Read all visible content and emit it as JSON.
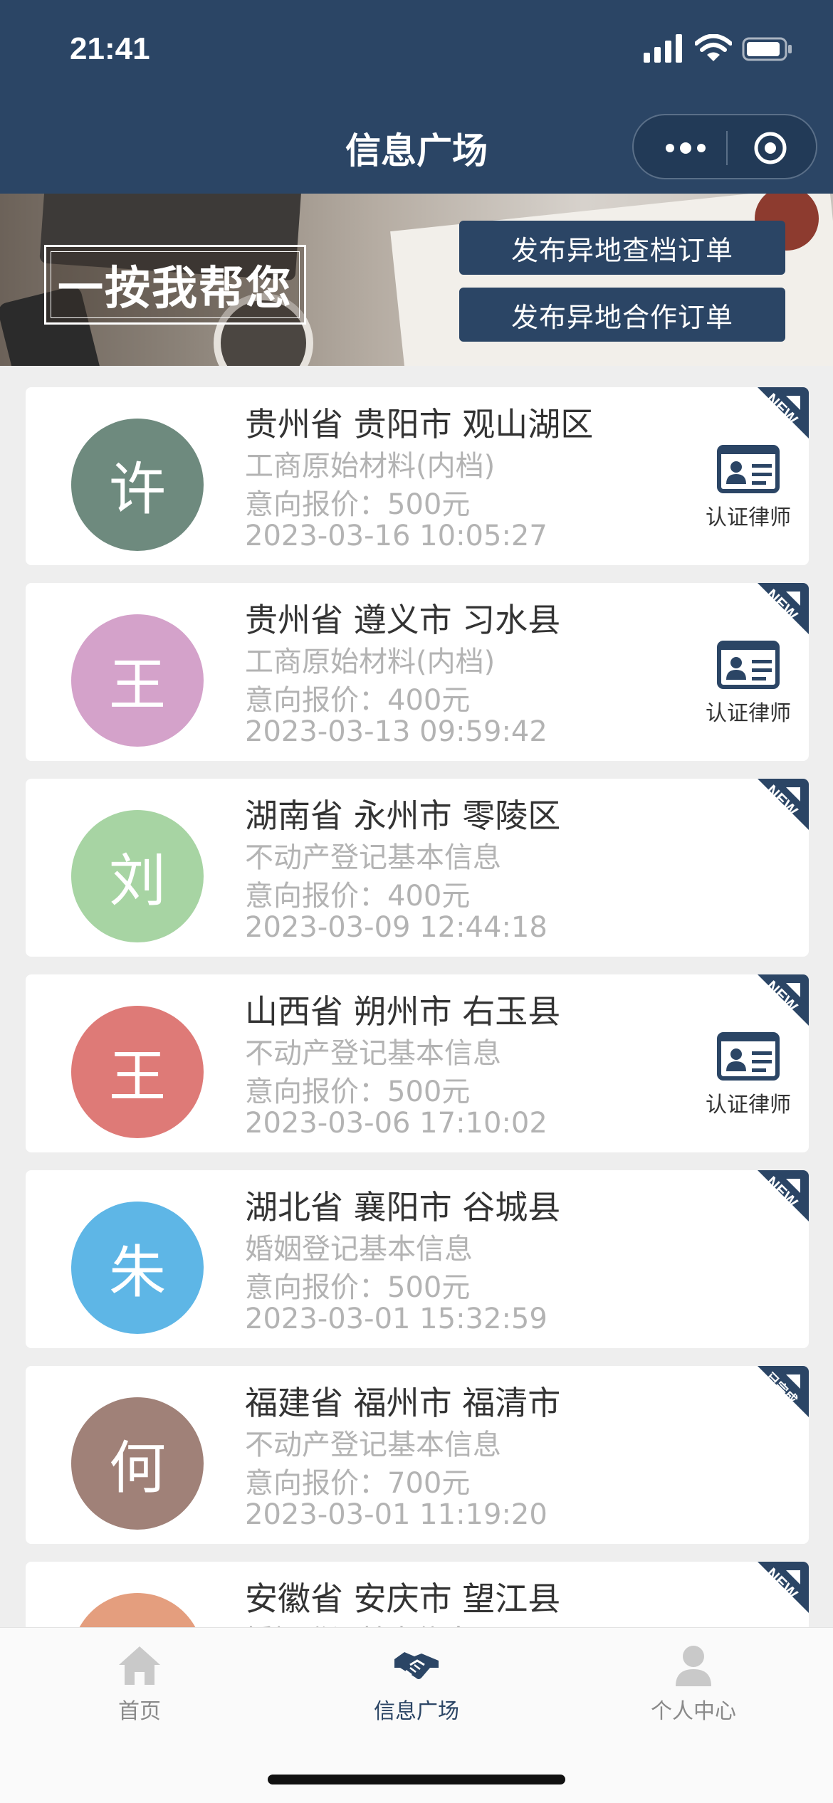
{
  "status_bar": {
    "time": "21:41"
  },
  "header": {
    "title": "信息广场"
  },
  "banner": {
    "slogan": "一按我帮您",
    "buttons": [
      "发布异地查档订单",
      "发布异地合作订单"
    ]
  },
  "cards": [
    {
      "avatar_char": "许",
      "avatar_color": "#6e8a7e",
      "location": "贵州省 贵阳市 观山湖区",
      "type": "工商原始材料(内档)",
      "price": "意向报价：500元",
      "date": "2023-03-16 10:05:27",
      "badge": "NEW",
      "certified_label": "认证律师"
    },
    {
      "avatar_char": "王",
      "avatar_color": "#d4a2ca",
      "location": "贵州省 遵义市 习水县",
      "type": "工商原始材料(内档)",
      "price": "意向报价：400元",
      "date": "2023-03-13 09:59:42",
      "badge": "NEW",
      "certified_label": "认证律师"
    },
    {
      "avatar_char": "刘",
      "avatar_color": "#a7d4a3",
      "location": "湖南省 永州市 零陵区",
      "type": "不动产登记基本信息",
      "price": "意向报价：400元",
      "date": "2023-03-09 12:44:18",
      "badge": "NEW",
      "certified_label": ""
    },
    {
      "avatar_char": "王",
      "avatar_color": "#de7a77",
      "location": "山西省 朔州市 右玉县",
      "type": "不动产登记基本信息",
      "price": "意向报价：500元",
      "date": "2023-03-06 17:10:02",
      "badge": "NEW",
      "certified_label": "认证律师"
    },
    {
      "avatar_char": "朱",
      "avatar_color": "#5eb6e6",
      "location": "湖北省 襄阳市 谷城县",
      "type": "婚姻登记基本信息",
      "price": "意向报价：500元",
      "date": "2023-03-01 15:32:59",
      "badge": "NEW",
      "certified_label": ""
    },
    {
      "avatar_char": "何",
      "avatar_color": "#a08178",
      "location": "福建省 福州市 福清市",
      "type": "不动产登记基本信息",
      "price": "意向报价：700元",
      "date": "2023-03-01 11:19:20",
      "badge": "已完成",
      "certified_label": ""
    },
    {
      "avatar_char": "",
      "avatar_color": "#e49e7e",
      "location": "安徽省 安庆市 望江县",
      "type": "婚姻登记基本信息",
      "price": "",
      "date": "",
      "badge": "NEW",
      "certified_label": ""
    }
  ],
  "colors": {
    "header_bg": "#2b4565",
    "accent": "#2b4565",
    "muted_text": "#b3b3b3"
  },
  "tabbar": {
    "tabs": [
      {
        "label": "首页",
        "icon": "home-icon",
        "active": false
      },
      {
        "label": "信息广场",
        "icon": "handshake-icon",
        "active": true
      },
      {
        "label": "个人中心",
        "icon": "user-icon",
        "active": false
      }
    ]
  }
}
